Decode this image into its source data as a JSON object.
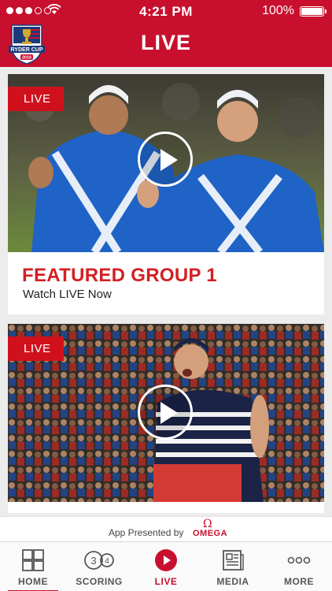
{
  "status_bar": {
    "time": "4:21 PM",
    "battery": "100%"
  },
  "header": {
    "title": "LIVE",
    "logo_text": "RYDER CUP",
    "logo_year": "2016"
  },
  "cards": [
    {
      "badge": "LIVE",
      "title": "FEATURED GROUP 1",
      "subtitle": "Watch LIVE Now"
    },
    {
      "badge": "LIVE"
    }
  ],
  "sponsor": {
    "presented_by": "App Presented by",
    "symbol": "Ω",
    "brand": "OMEGA"
  },
  "tabs": [
    {
      "label": "HOME",
      "icon": "grid-icon",
      "active": false
    },
    {
      "label": "SCORING",
      "icon": "scoring-icon",
      "scoring_left": "3",
      "scoring_right": "4",
      "active": false
    },
    {
      "label": "LIVE",
      "icon": "play-icon",
      "active": true
    },
    {
      "label": "MEDIA",
      "icon": "newspaper-icon",
      "active": false
    },
    {
      "label": "MORE",
      "icon": "more-icon",
      "active": false
    }
  ],
  "colors": {
    "brand_red": "#c8102e",
    "euro_blue": "#1f63c6",
    "usa_navy": "#16224a"
  }
}
